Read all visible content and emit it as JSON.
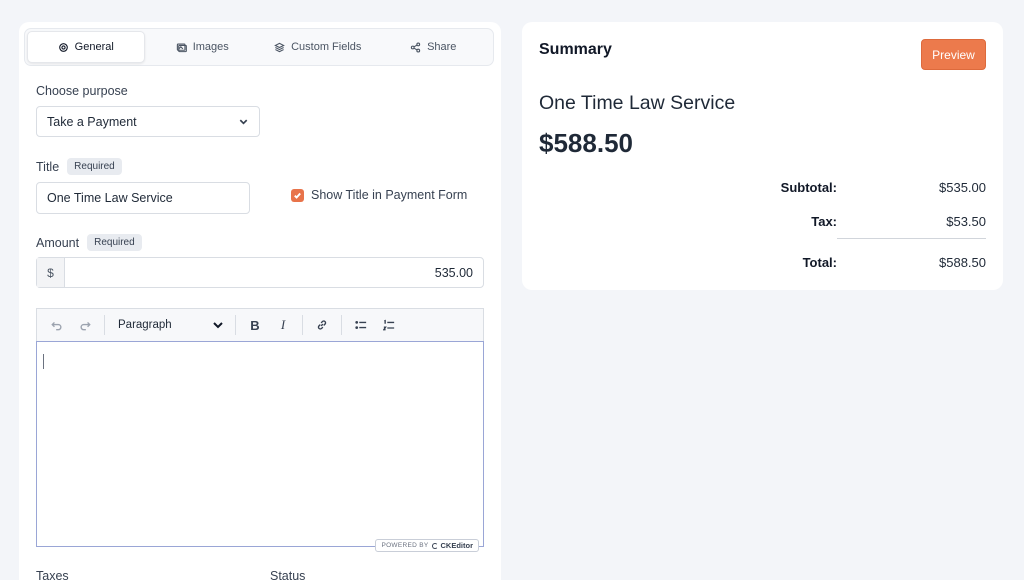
{
  "tabs": [
    {
      "label": "General",
      "icon": "gear-icon"
    },
    {
      "label": "Images",
      "icon": "images-icon"
    },
    {
      "label": "Custom Fields",
      "icon": "layers-icon"
    },
    {
      "label": "Share",
      "icon": "share-icon"
    }
  ],
  "form": {
    "purpose_label": "Choose purpose",
    "purpose_value": "Take a Payment",
    "title_label": "Title",
    "required_badge": "Required",
    "title_value": "One Time Law Service",
    "show_title_label": "Show Title in Payment Form",
    "show_title_checked": true,
    "amount_label": "Amount",
    "amount_prefix": "$",
    "amount_value": "535.00",
    "editor": {
      "paragraph_label": "Paragraph",
      "powered_by": "POWERED BY",
      "brand": "CKEditor"
    },
    "taxes_label": "Taxes",
    "status_label": "Status"
  },
  "summary": {
    "title": "Summary",
    "preview_label": "Preview",
    "service_name": "One Time Law Service",
    "total_big": "$588.50",
    "subtotal_label": "Subtotal:",
    "subtotal_value": "$535.00",
    "tax_label": "Tax:",
    "tax_value": "$53.50",
    "total_label": "Total:",
    "total_value": "$588.50"
  },
  "colors": {
    "accent": "#ec7a4c",
    "background": "#f3f5f9"
  }
}
